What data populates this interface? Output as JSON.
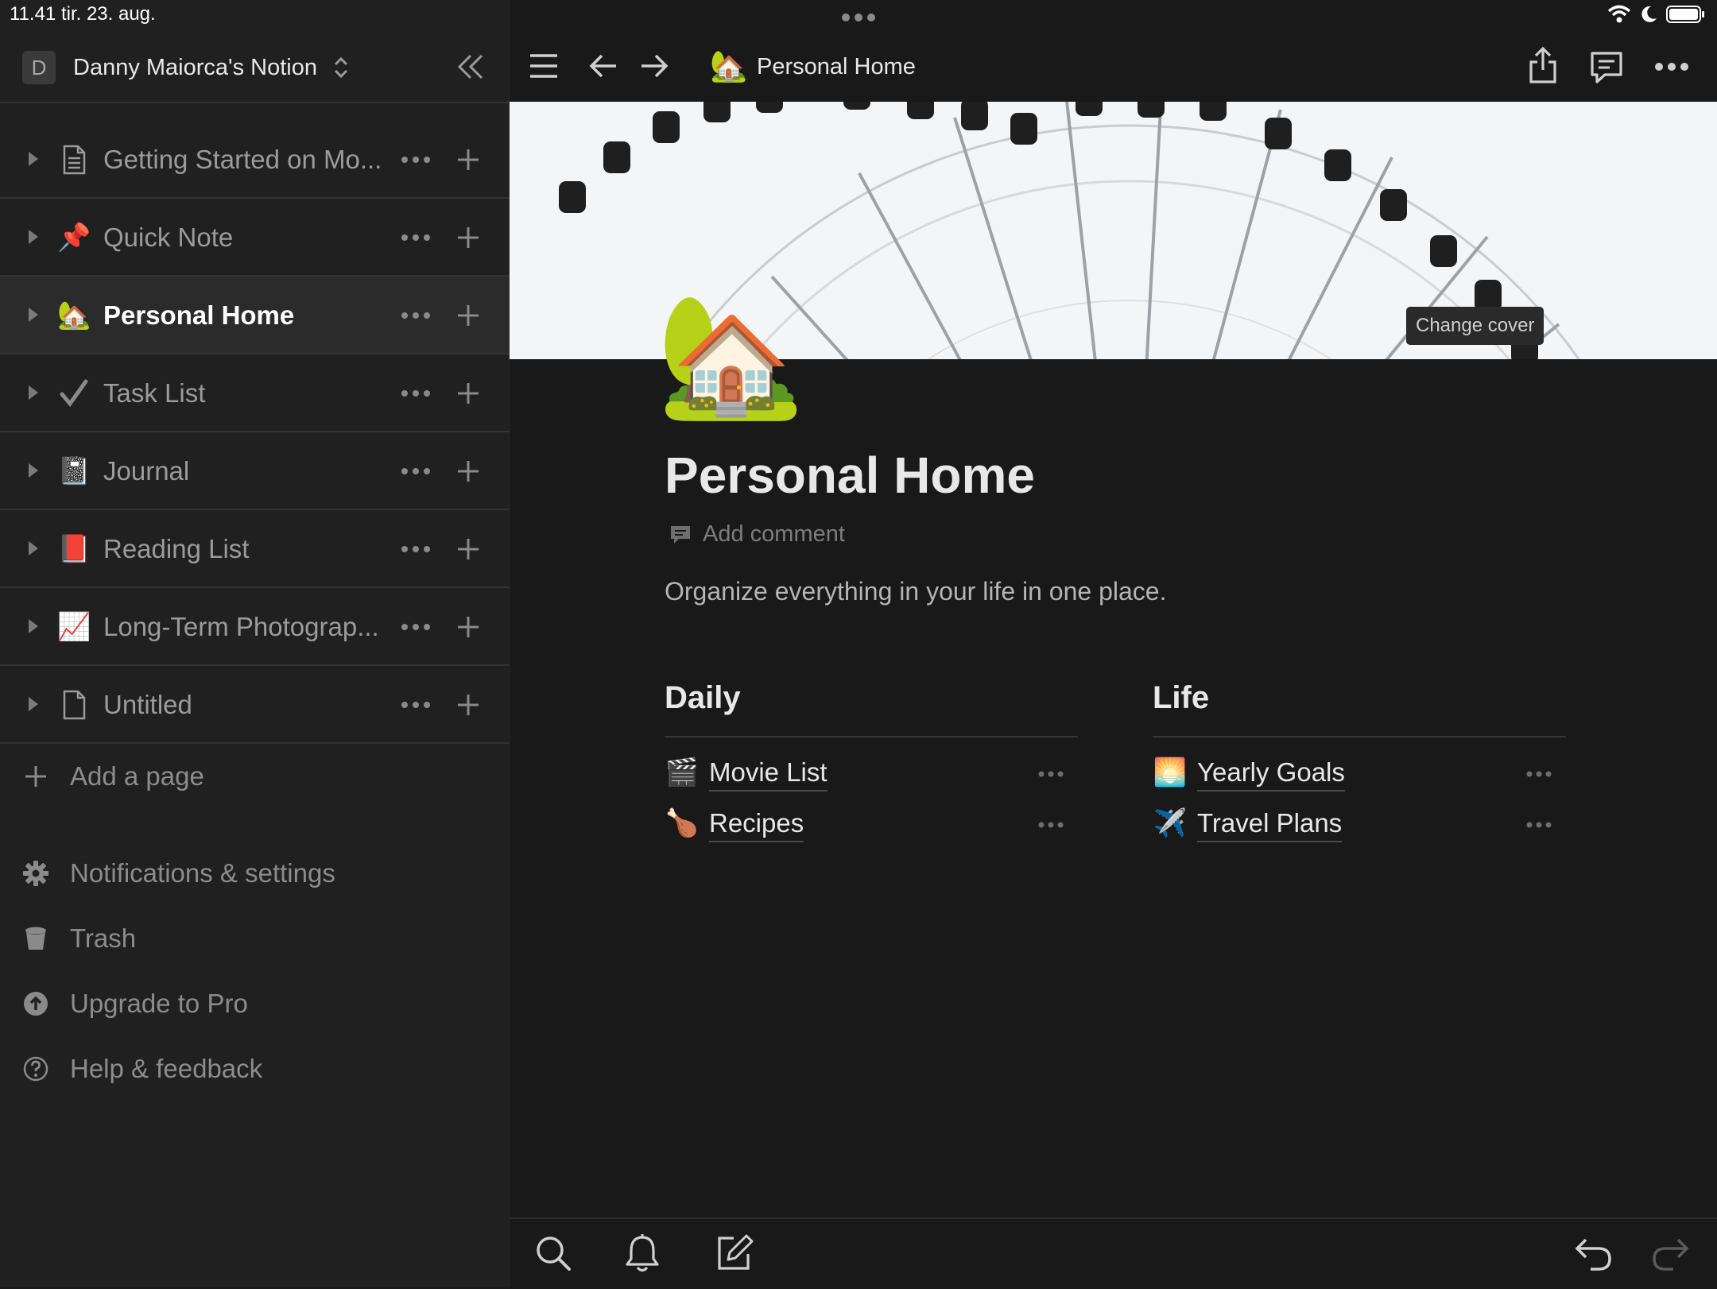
{
  "status_bar": {
    "time": "11.41",
    "date": "tir. 23. aug."
  },
  "sidebar": {
    "workspace_initial": "D",
    "workspace_name": "Danny Maiorca's Notion",
    "pages": [
      {
        "label": "Getting Started on Mo...",
        "icon": "📄"
      },
      {
        "label": "Quick Note",
        "icon": "📌"
      },
      {
        "label": "Personal Home",
        "icon": "🏡",
        "active": true
      },
      {
        "label": "Task List",
        "icon": "✔️"
      },
      {
        "label": "Journal",
        "icon": "📓"
      },
      {
        "label": "Reading List",
        "icon": "📕"
      },
      {
        "label": "Long-Term Photograp...",
        "icon": "📈"
      },
      {
        "label": "Untitled",
        "icon": "📄"
      }
    ],
    "add_page": "Add a page",
    "footer": {
      "settings": "Notifications & settings",
      "trash": "Trash",
      "upgrade": "Upgrade to Pro",
      "help": "Help & feedback"
    }
  },
  "topbar": {
    "page_icon": "🏡",
    "title": "Personal Home"
  },
  "cover": {
    "change_cover": "Change cover"
  },
  "page": {
    "icon": "🏡",
    "title": "Personal Home",
    "add_comment": "Add comment",
    "description": "Organize everything in your life in one place.",
    "columns": [
      {
        "heading": "Daily",
        "links": [
          {
            "icon": "🎬",
            "label": "Movie List"
          },
          {
            "icon": "🍗",
            "label": "Recipes"
          }
        ]
      },
      {
        "heading": "Life",
        "links": [
          {
            "icon": "🌅",
            "label": "Yearly Goals"
          },
          {
            "icon": "✈️",
            "label": "Travel Plans"
          }
        ]
      }
    ]
  },
  "colors": {
    "background": "#191919",
    "sidebar": "#202020",
    "active_row": "#2b2b2b",
    "text_primary": "#e8e8e8",
    "text_muted": "#9b9b9b"
  }
}
